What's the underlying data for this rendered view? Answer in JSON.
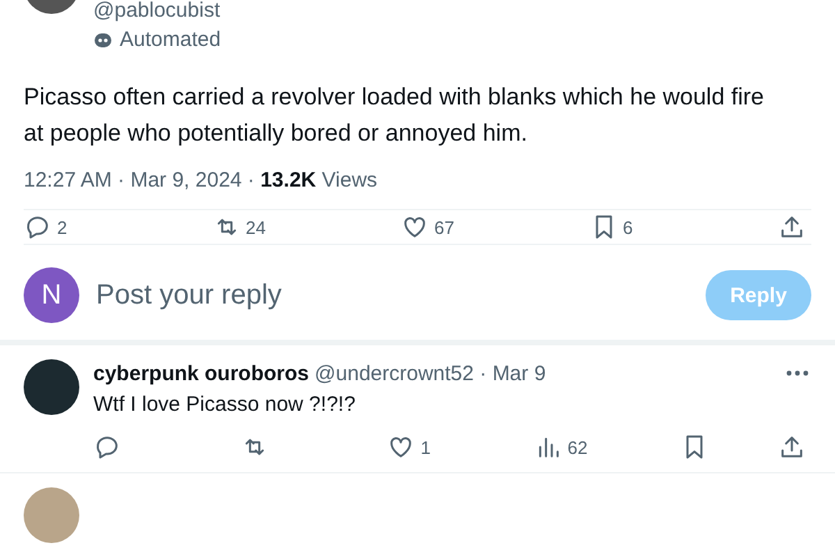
{
  "author": {
    "handle": "@pablocubist",
    "label": "Automated"
  },
  "tweet": {
    "text": "Picasso often carried a revolver loaded with blanks which he would fire at people who potentially bored or annoyed him.",
    "time": "12:27 AM · Mar 9, 2024 · ",
    "views_count": "13.2K",
    "views_label": " Views"
  },
  "actions": [
    {
      "kind": "reply",
      "count": "2"
    },
    {
      "kind": "repost",
      "count": "24"
    },
    {
      "kind": "like",
      "count": "67"
    },
    {
      "kind": "bookmark",
      "count": "6"
    },
    {
      "kind": "share"
    }
  ],
  "composer": {
    "avatar_letter": "N",
    "placeholder": "Post your reply",
    "button": "Reply",
    "disabled": true
  },
  "replies": [
    {
      "name": "cyberpunk ouroboros",
      "meta": "@undercrownt52 · Mar 9",
      "text": "Wtf I love Picasso now ?!?!?",
      "actions": [
        {
          "kind": "reply"
        },
        {
          "kind": "repost"
        },
        {
          "kind": "like",
          "count": "1"
        },
        {
          "kind": "views",
          "count": "62"
        },
        {
          "kind": "bookmark"
        },
        {
          "kind": "share"
        }
      ]
    }
  ]
}
